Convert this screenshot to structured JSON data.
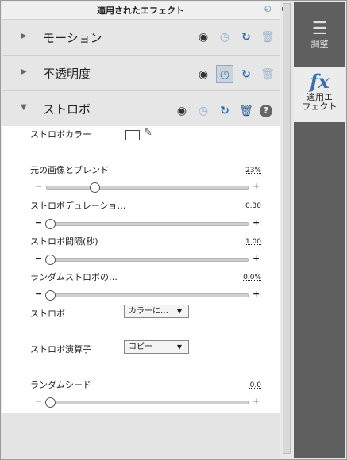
{
  "header": {
    "title": "適用されたエフェクト"
  },
  "sections": [
    {
      "label": "モーション"
    },
    {
      "label": "不透明度"
    },
    {
      "label": "ストロボ"
    }
  ],
  "properties": {
    "color": {
      "label": "ストロボカラー"
    },
    "blend": {
      "label": "元の画像とブレンド",
      "value": "23%",
      "fraction": 0.23
    },
    "duration": {
      "label": "ストロボデュレーショ…",
      "value": "0.30",
      "fraction": 0.0
    },
    "interval": {
      "label": "ストロボ間隔(秒)",
      "value": "1.00",
      "fraction": 0.0
    },
    "random": {
      "label": "ランダムストロボの…",
      "value": "0.0%",
      "fraction": 0.0
    },
    "strobe": {
      "label": "ストロボ",
      "selected": "カラーに…"
    },
    "operator": {
      "label": "ストロボ演算子",
      "selected": "コピー"
    },
    "seed": {
      "label": "ランダムシード",
      "value": "0.0",
      "fraction": 0.0
    }
  },
  "slider_signs": {
    "minus": "−",
    "plus": "+"
  },
  "right_panel": {
    "adjust_label": "調整",
    "applied_label_1": "適用エ",
    "applied_label_2": "フェクト",
    "fx_text": "fx"
  },
  "colors": {
    "accent": "#3b6fa8",
    "sidebar": "#5f5f5f"
  }
}
